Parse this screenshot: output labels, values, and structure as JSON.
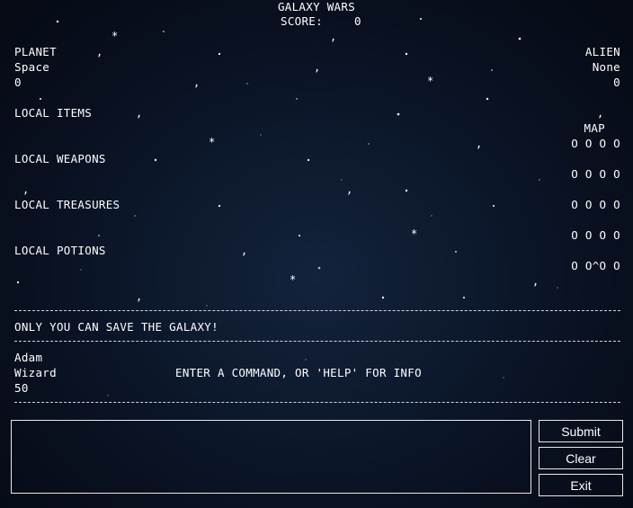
{
  "game": {
    "title": "GALAXY WARS",
    "score_label": "SCORE:",
    "score_value": "0"
  },
  "planet": {
    "header": "PLANET",
    "name": "Space",
    "value": "0"
  },
  "alien": {
    "header": "ALIEN",
    "name": "None",
    "value": "0"
  },
  "local": {
    "items": "LOCAL ITEMS",
    "weapons": "LOCAL WEAPONS",
    "treasures": "LOCAL TREASURES",
    "potions": "LOCAL POTIONS"
  },
  "map": {
    "label": "MAP",
    "rows": [
      "O O O O",
      "O O O O",
      "O O O O",
      "O O O O",
      "O O^O O"
    ]
  },
  "message": "ONLY YOU CAN SAVE THE GALAXY!",
  "player": {
    "name": "Adam",
    "class": "Wizard",
    "value": "50"
  },
  "prompt": "ENTER A COMMAND, OR 'HELP' FOR INFO",
  "rule_text": "------------------------------------------------------------------------------------------------",
  "input": {
    "value": ""
  },
  "buttons": {
    "submit": "Submit",
    "clear": "Clear",
    "exit": "Exit"
  }
}
